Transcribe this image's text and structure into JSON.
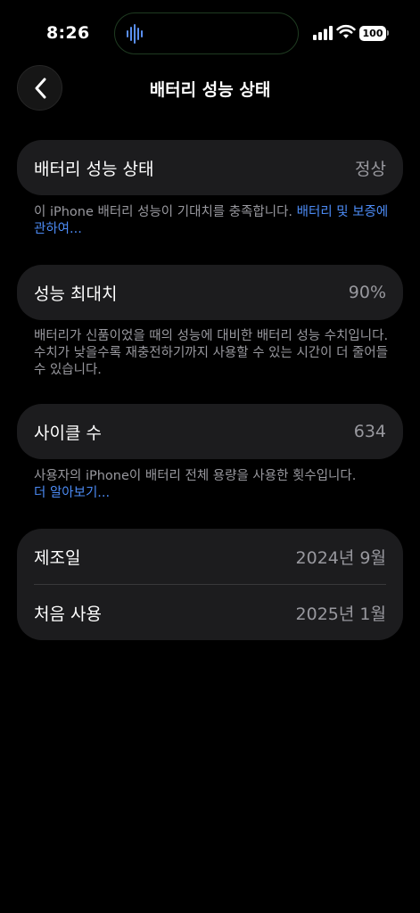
{
  "status_bar": {
    "time": "8:26",
    "battery_level": "100"
  },
  "nav": {
    "title": "배터리 성능 상태"
  },
  "battery_health": {
    "label": "배터리 성능 상태",
    "value": "정상",
    "footnote_text": "이 iPhone 배터리 성능이 기대치를 충족합니다. ",
    "footnote_link": "배터리 및 보증에 관하여..."
  },
  "max_capacity": {
    "label": "성능 최대치",
    "value": "90%",
    "footnote_text": "배터리가 신품이었을 때의 성능에 대비한 배터리 성능 수치입니다. 수치가 낮을수록 재충전하기까지 사용할 수 있는 시간이 더 줄어들 수 있습니다."
  },
  "cycle_count": {
    "label": "사이클 수",
    "value": "634",
    "footnote_text": "사용자의 iPhone이 배터리 전체 용량을 사용한 횟수입니다.",
    "footnote_link": "더 알아보기..."
  },
  "dates": {
    "manufactured_label": "제조일",
    "manufactured_value": "2024년 9월",
    "first_use_label": "처음 사용",
    "first_use_value": "2025년 1월"
  },
  "colors": {
    "background": "#000000",
    "card": "#1c1c1e",
    "secondary_text": "#98989e",
    "link": "#4c8bf5"
  }
}
